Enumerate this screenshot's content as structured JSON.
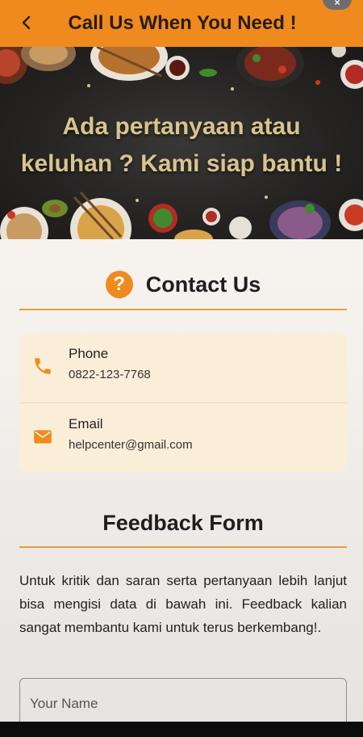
{
  "appbar": {
    "title": "Call Us When You Need !",
    "back_icon": "arrow-back-icon",
    "color": "#ef8a1f"
  },
  "hero": {
    "line1": "Ada pertanyaan atau",
    "line2": "keluhan ? Kami siap bantu !"
  },
  "contact": {
    "title": "Contact Us",
    "icon": "help-question-icon",
    "phone": {
      "label": "Phone",
      "value": "0822-123-7768",
      "icon": "phone-icon"
    },
    "email": {
      "label": "Email",
      "value": "helpcenter@gmail.com",
      "icon": "mail-icon"
    }
  },
  "feedback": {
    "title": "Feedback Form",
    "description": "Untuk kritik dan saran serta pertanyaan lebih lanjut bisa mengisi data di bawah ini. Feedback kalian sangat membantu kami untuk terus berkembang!.",
    "name_placeholder": "Your Name"
  },
  "colors": {
    "accent": "#ef8a1f",
    "card": "#fbeed9",
    "hero_text": "#d8c48e"
  }
}
